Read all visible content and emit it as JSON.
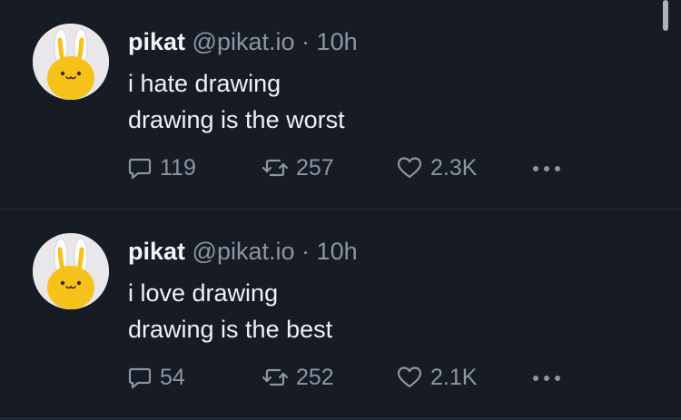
{
  "tweets": [
    {
      "name": "pikat",
      "handle": "@pikat.io",
      "separator": "·",
      "time": "10h",
      "lines": [
        "i hate drawing",
        "drawing is the worst"
      ],
      "replies": "119",
      "retweets": "257",
      "likes": "2.3K"
    },
    {
      "name": "pikat",
      "handle": "@pikat.io",
      "separator": "·",
      "time": "10h",
      "lines": [
        "i love drawing",
        "drawing is the best"
      ],
      "replies": "54",
      "retweets": "252",
      "likes": "2.1K"
    }
  ],
  "icons": {
    "reply": "comment-bubble-icon",
    "retweet": "retweet-arrows-icon",
    "like": "heart-icon",
    "more": "more-horizontal-icon"
  },
  "colors": {
    "background": "#161b24",
    "text": "#eef1f5",
    "muted": "#8c96a4",
    "avatar_bg": "#e9e7ea",
    "avatar_character": "#f6c21a",
    "divider": "#2a3240"
  }
}
